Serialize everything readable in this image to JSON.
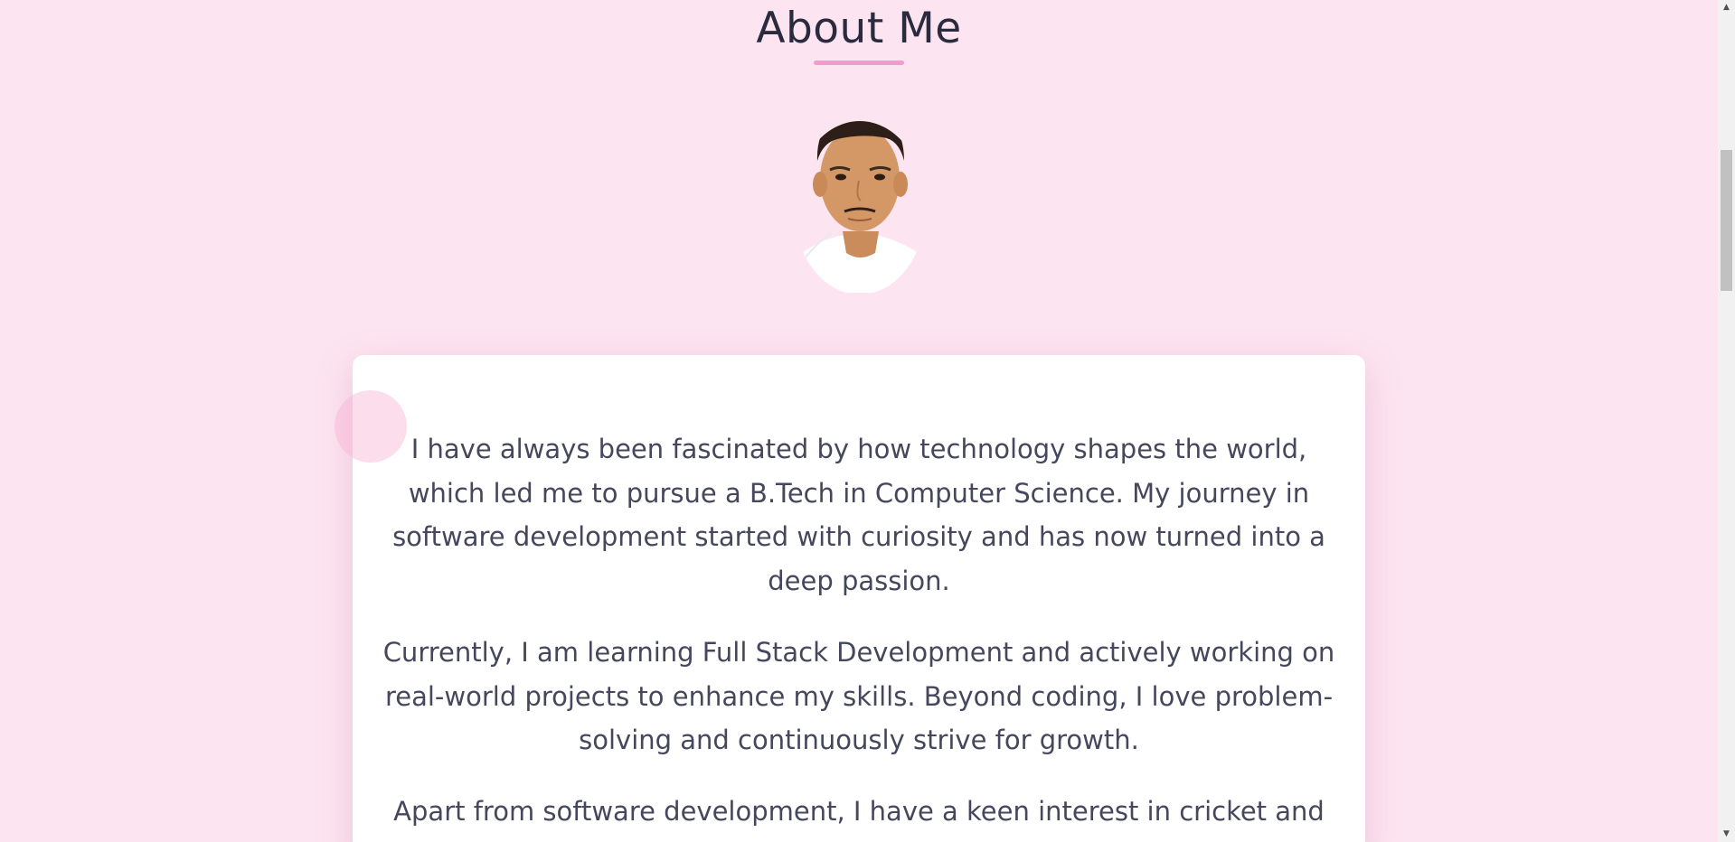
{
  "about": {
    "title": "About Me",
    "avatar_alt": "Profile photo",
    "paragraphs": [
      "I have always been fascinated by how technology shapes the world, which led me to pursue a B.Tech in Computer Science. My journey in software development started with curiosity and has now turned into a deep passion.",
      "Currently, I am learning Full Stack Development and actively working on real-world projects to enhance my skills. Beyond coding, I love problem-solving and continuously strive for growth.",
      "Apart from software development, I have a keen interest in cricket and"
    ]
  },
  "colors": {
    "background": "#fde4f1",
    "accent": "#f39ccb",
    "card": "#ffffff",
    "text": "#45475c",
    "title": "#2b2b3f"
  },
  "scrollbar": {
    "up_icon": "triangle-up-icon",
    "down_icon": "triangle-down-icon"
  }
}
